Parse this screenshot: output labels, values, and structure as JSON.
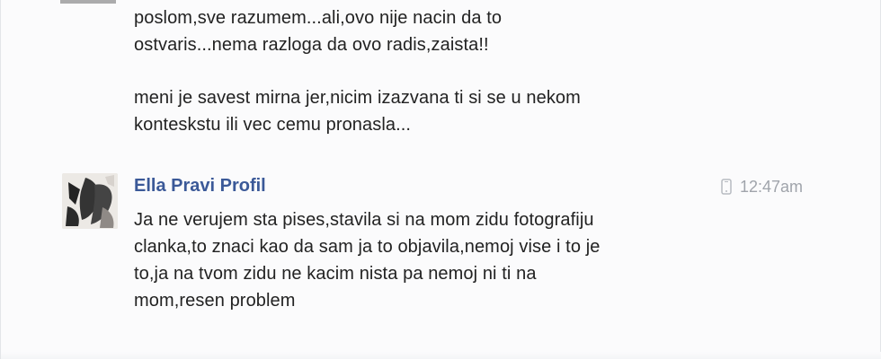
{
  "conversation": {
    "previous_message": {
      "lines_block_1": "poslom,sve razumem...ali,ovo nije nacin da to\nostvaris...nema razloga da ovo radis,zaista!!",
      "lines_block_2": "meni je savest mirna jer,nicim izazvana ti si se u nekom\nkonteskstu ili vec cemu pronasla..."
    },
    "reply": {
      "sender_name": "Ella Pravi Profil",
      "timestamp": "12:47am",
      "text": "Ja ne verujem sta pises,stavila si na mom zidu fotografiju\nclanka,to znaci kao da sam ja to objavila,nemoj vise i to je\nto,ja na tvom zidu ne kacim nista pa nemoj ni ti na\nmom,resen problem",
      "timestamp_icon": "phone-icon"
    }
  },
  "colors": {
    "name": "#3b5998",
    "text": "#222222",
    "timestamp": "#a0a4ab"
  }
}
